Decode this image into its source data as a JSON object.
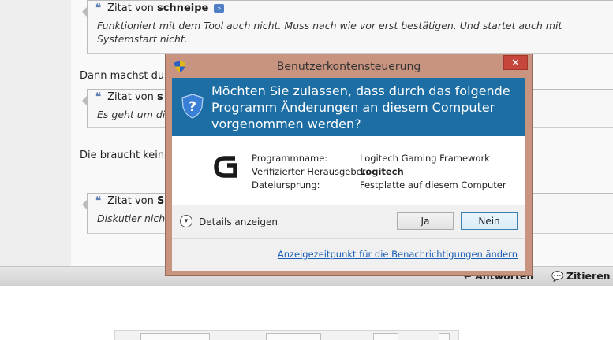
{
  "forum": {
    "quote1": {
      "prefix": "Zitat von",
      "author": "schneipe",
      "text": "Funktioniert mit dem Tool auch nicht. Muss nach wie vor erst bestätigen. Und startet auch mit Systemstart nicht."
    },
    "line1": "Dann machst du w",
    "quote2": {
      "prefix": "Zitat von",
      "author": "s",
      "text": "Es geht um die"
    },
    "line2": "Die braucht keine",
    "quote3": {
      "prefix": "Zitat von",
      "author": "S",
      "text": "Diskutier nicht"
    },
    "actions": {
      "reply": "Antworten",
      "quote": "Zitieren"
    }
  },
  "uac": {
    "title": "Benutzerkontensteuerung",
    "close_symbol": "✕",
    "question": "Möchten Sie zulassen, dass durch das folgende Programm Änderungen an diesem Computer vorgenommen werden?",
    "program_label": "Programmname:",
    "program_value": "Logitech Gaming Framework",
    "publisher_label": "Verifizierter Herausgeber:",
    "publisher_value": "Logitech",
    "origin_label": "Dateiursprung:",
    "origin_value": "Festplatte auf diesem Computer",
    "details_label": "Details anzeigen",
    "yes_label": "Ja",
    "no_label": "Nein",
    "notification_link": "Anzeigezeitpunkt für die Benachrichtigungen ändern"
  },
  "colors": {
    "uac_header": "#1c6ea4",
    "uac_frame": "#c9947f",
    "close_button": "#c7463b",
    "link": "#1a5db5"
  },
  "icons": {
    "quote": "quote-icon",
    "goto": "goto-post-icon",
    "shield": "uac-shield-icon",
    "logo": "logitech-g-logo",
    "details": "chevron-down-icon",
    "reply": "reply-icon",
    "quote_action": "speech-bubble-icon"
  }
}
